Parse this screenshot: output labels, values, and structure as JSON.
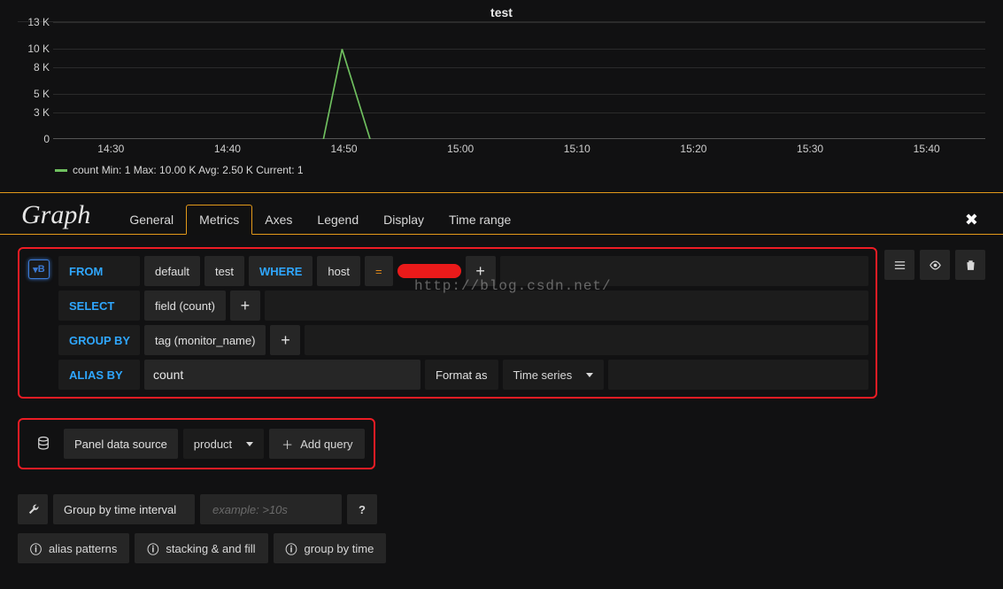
{
  "chart_data": {
    "type": "line",
    "title": "test",
    "xlabel": "",
    "ylabel": "",
    "x_ticks": [
      "14:30",
      "14:40",
      "14:50",
      "15:00",
      "15:10",
      "15:20",
      "15:30",
      "15:40"
    ],
    "y_ticks": [
      "0",
      "3 K",
      "5 K",
      "8 K",
      "10 K",
      "13 K"
    ],
    "ylim": [
      0,
      13000
    ],
    "series": [
      {
        "name": "count",
        "color": "#6fbf5f",
        "points": [
          {
            "x": "14:50",
            "y": 0
          },
          {
            "x": "14:51",
            "y": 10000
          },
          {
            "x": "14:53",
            "y": 0
          }
        ]
      }
    ],
    "legend_stats": {
      "min": "1",
      "max": "10.00 K",
      "avg": "2.50 K",
      "current": "1"
    }
  },
  "legend_text": "count  Min: 1  Max: 10.00 K  Avg: 2.50 K  Current: 1",
  "panel_title": "Graph",
  "tabs": [
    "General",
    "Metrics",
    "Axes",
    "Legend",
    "Display",
    "Time range"
  ],
  "active_tab": "Metrics",
  "query": {
    "letter": "B",
    "from_kw": "FROM",
    "from_measurement_policy": "default",
    "from_measurement_name": "test",
    "where_kw": "WHERE",
    "where_tag": "host",
    "where_op": "=",
    "select_kw": "SELECT",
    "select_field": "field (count)",
    "groupby_kw": "GROUP BY",
    "groupby_tag": "tag (monitor_name)",
    "aliasby_kw": "ALIAS BY",
    "alias_value": "count",
    "format_label": "Format as",
    "format_value": "Time series"
  },
  "datasource": {
    "label": "Panel data source",
    "value": "product",
    "add_query": "Add query"
  },
  "interval": {
    "label": "Group by time interval",
    "placeholder": "example: >10s"
  },
  "help": {
    "alias": "alias patterns",
    "stacking": "stacking & and fill",
    "groupby": "group by time"
  },
  "watermark": "http://blog.csdn.net/"
}
